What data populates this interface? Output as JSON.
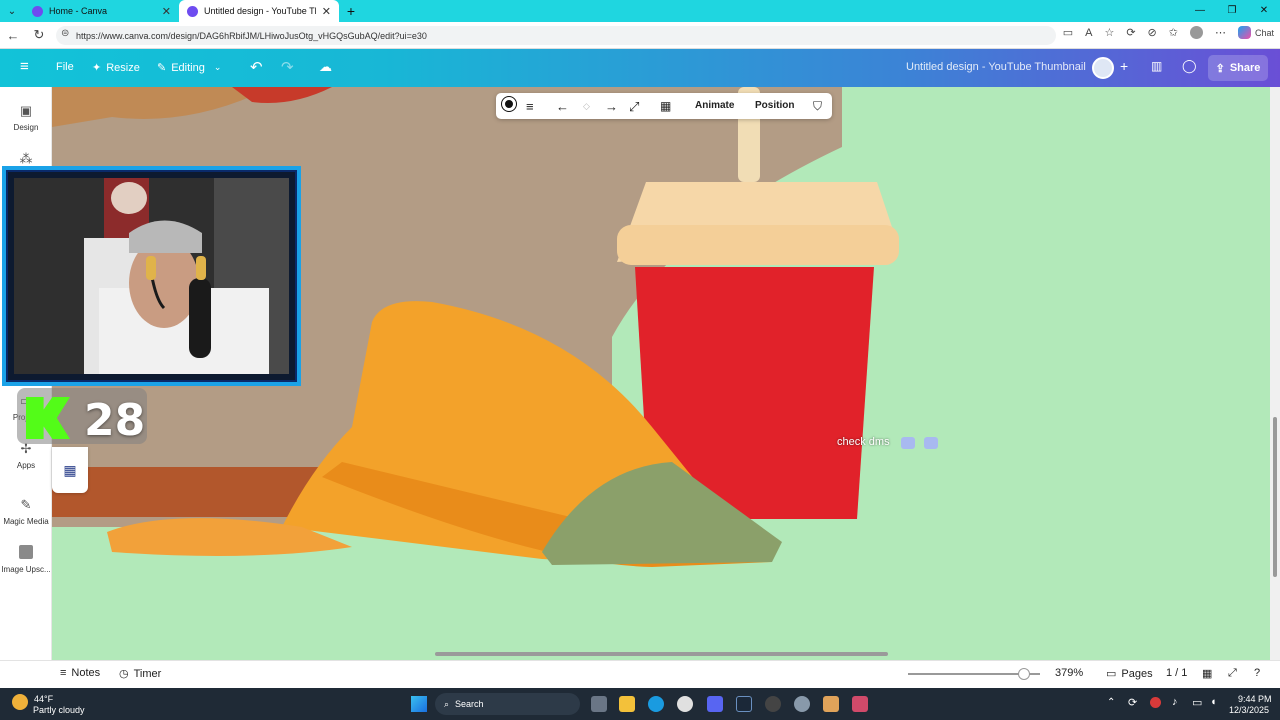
{
  "browser": {
    "tabs": [
      {
        "title": "Home - Canva",
        "active": false
      },
      {
        "title": "Untitled design - YouTube Thumb",
        "active": true
      }
    ],
    "url": "https://www.canva.com/design/DAG6hRbifJM/LHiwoJusOtg_vHGQsGubAQ/edit?ui=e30",
    "chat_label": "Chat"
  },
  "canva_toolbar": {
    "file_label": "File",
    "resize_label": "Resize",
    "editing_label": "Editing",
    "design_title": "Untitled design - YouTube Thumbnail",
    "share_label": "Share"
  },
  "sidebar": {
    "items": [
      {
        "label": "Design",
        "icon": "layout-icon"
      },
      {
        "label": "Proj",
        "icon": "folder-icon"
      },
      {
        "label": "Apps",
        "icon": "apps-icon"
      },
      {
        "label": "Magic Media",
        "icon": "magic-media-icon"
      },
      {
        "label": "Image Upsc...",
        "icon": "image-upscaler-icon"
      }
    ]
  },
  "float_toolbar": {
    "animate_label": "Animate",
    "position_label": "Position"
  },
  "overlay": {
    "counter": "28",
    "check_dms": "check dms"
  },
  "bottombar": {
    "notes_label": "Notes",
    "timer_label": "Timer",
    "zoom": "379%",
    "pages_label": "Pages",
    "page_indicator": "1 / 1"
  },
  "taskbar": {
    "weather_temp": "44°F",
    "weather_desc": "Partly cloudy",
    "search_label": "Search",
    "time": "9:44 PM",
    "date": "12/3/2025"
  },
  "colors": {
    "canvas_bg": "#b2e9b9",
    "toolbar_gradient_start": "#12c3d8",
    "toolbar_gradient_end": "#6a4fd6",
    "tab_strip": "#1fd6e0",
    "webcam_border": "#1aa2e8"
  }
}
